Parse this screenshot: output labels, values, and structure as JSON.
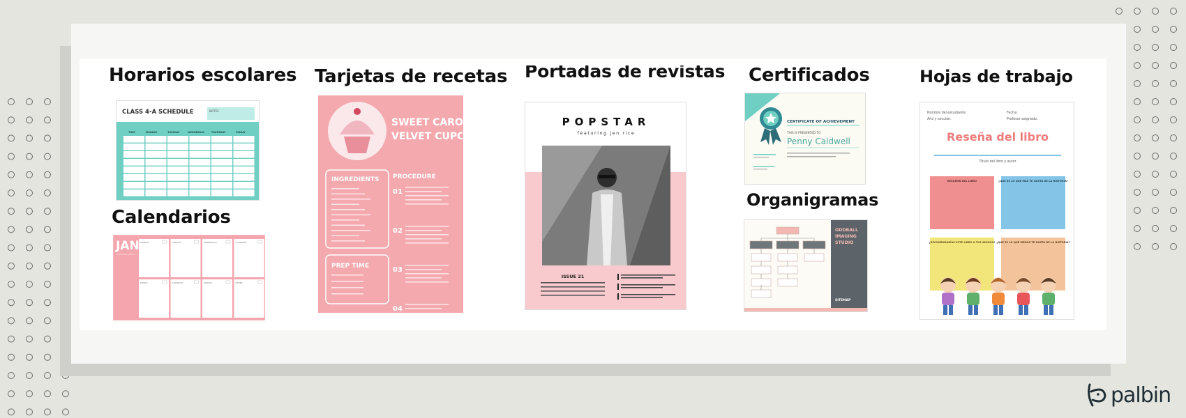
{
  "sections": {
    "horarios": "Horarios escolares",
    "calendarios": "Calendarios",
    "recetas": "Tarjetas de recetas",
    "revistas": "Portadas de revistas",
    "certificados": "Certificados",
    "organigramas": "Organigramas",
    "hojas": "Hojas de trabajo"
  },
  "schedule": {
    "title": "CLASS 4-A SCHEDULE",
    "notes": "NOTES",
    "days": [
      "TIME",
      "MONDAY",
      "TUESDAY",
      "WEDNESDAY",
      "THURSDAY",
      "FRIDAY"
    ]
  },
  "calendar": {
    "month": "JAN",
    "week_top": [
      "MONDAY",
      "TUESDAY",
      "WEDNESDAY",
      "THURSDAY"
    ],
    "week_bottom": [
      "FRIDAY",
      "SATURDAY",
      "SUNDAY",
      "NOTES"
    ]
  },
  "recipe": {
    "title_line1": "SWEET CAROL'S",
    "title_line2": "VELVET CUPCAKE",
    "ingredients": "INGREDIENTS",
    "procedure": "PROCEDURE",
    "prep_time": "PREP TIME",
    "steps": [
      "01",
      "02",
      "03",
      "04"
    ]
  },
  "magazine": {
    "brand": "POPSTAR",
    "subtitle": "featuring jen rice",
    "issue": "ISSUE 21"
  },
  "certificate": {
    "heading": "CERTIFICATE OF ACHIEVEMENT",
    "presented": "THIS IS PRESENTED TO",
    "name": "Penny Caldwell"
  },
  "org": {
    "studio_line1": "ODDBALL",
    "studio_line2": "IMAGING",
    "studio_line3": "STUDIO",
    "sitemap": "SITEMAP"
  },
  "worksheet": {
    "student": "Nombre del estudiante:",
    "fecha": "Fecha:",
    "seccion": "Año y sección:",
    "profesor": "Profesor asignado:",
    "title": "Reseña del libro",
    "subtitle": "Título del libro y autor",
    "box1": "RESUMEN DEL LIBRO",
    "box2": "¿QUÉ ES LO QUE MÁS TE GUSTA DE LA HISTORIA?",
    "box3": "¿RECOMENDARÍAS ESTE LIBRO A TUS AMIGOS?",
    "box4": "¿QUÉ ES LO QUE MENOS TE GUSTA DE LA HISTORIA?"
  },
  "brand": {
    "logo_text": "palbin"
  },
  "colors": {
    "teal": "#6fcfc3",
    "pink": "#f5b5ba",
    "coral": "#ef6d6d",
    "red": "#f08f8f",
    "blue": "#84c4e6",
    "yellow": "#f2e57a",
    "peach": "#f3c49b"
  }
}
